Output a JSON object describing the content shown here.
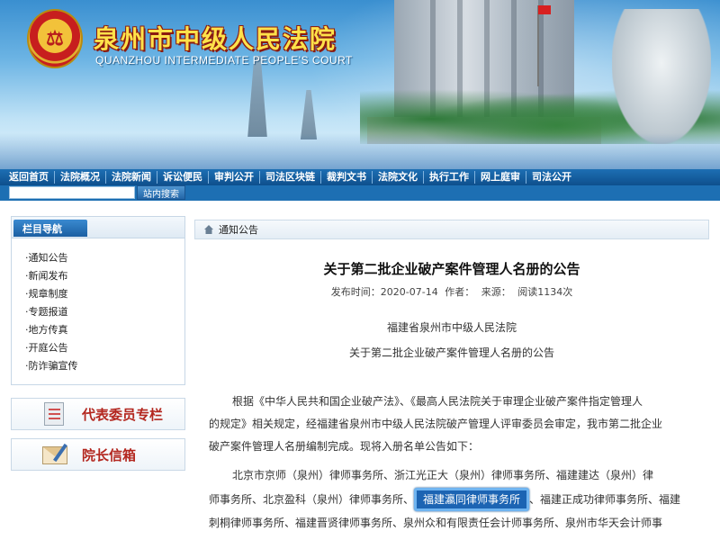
{
  "header": {
    "title": "泉州市中级人民法院",
    "subtitle": "QUANZHOU INTERMEDIATE PEOPLE'S COURT",
    "brand_color": "#1d6fb3"
  },
  "nav": {
    "items": [
      "返回首页",
      "法院概况",
      "法院新闻",
      "诉讼便民",
      "审判公开",
      "司法区块链",
      "裁判文书",
      "法院文化",
      "执行工作",
      "网上庭审",
      "司法公开"
    ]
  },
  "search": {
    "placeholder": "",
    "button_label": "站内搜索"
  },
  "sidebar": {
    "heading": "栏目导航",
    "items": [
      "·通知公告",
      "·新闻发布",
      "·规章制度",
      "·专题报道",
      "·地方传真",
      "·开庭公告",
      "·防诈骗宣传"
    ],
    "cards": [
      {
        "label": "代表委员专栏",
        "icon": "document-icon"
      },
      {
        "label": "院长信箱",
        "icon": "mail-icon"
      }
    ]
  },
  "main": {
    "section_label": "通知公告",
    "article": {
      "title": "关于第二批企业破产案件管理人名册的公告",
      "meta_time": "发布时间：2020-07-14",
      "meta_author": "作者：",
      "meta_source": "来源：",
      "meta_views": "阅读1134次",
      "issuer": "福建省泉州市中级人民法院",
      "subtitle": "关于第二批企业破产案件管理人名册的公告",
      "para1_line1": "根据《中华人民共和国企业破产法》、《最高人民法院关于审理企业破产案件指定管理人",
      "para1_line2": "的规定》相关规定，经福建省泉州市中级人民法院破产管理人评审委员会审定，我市第二批企业",
      "para1_line3": "破产案件管理人名册编制完成。现将入册名单公告如下：",
      "para2_line1": "北京市京师（泉州）律师事务所、浙江光正大（泉州）律师事务所、福建建达（泉州）律",
      "para2_line2_before": "师事务所、北京盈科（泉州）律师事务所、",
      "para2_line2_link": "福建瀛同律师事务所",
      "para2_line2_after": "、福建正成功律师事务所、福建",
      "para2_line3": "刺桐律师事务所、福建晋贤律师事务所、泉州众和有限责任会计师事务所、泉州市华天会计师事"
    }
  }
}
